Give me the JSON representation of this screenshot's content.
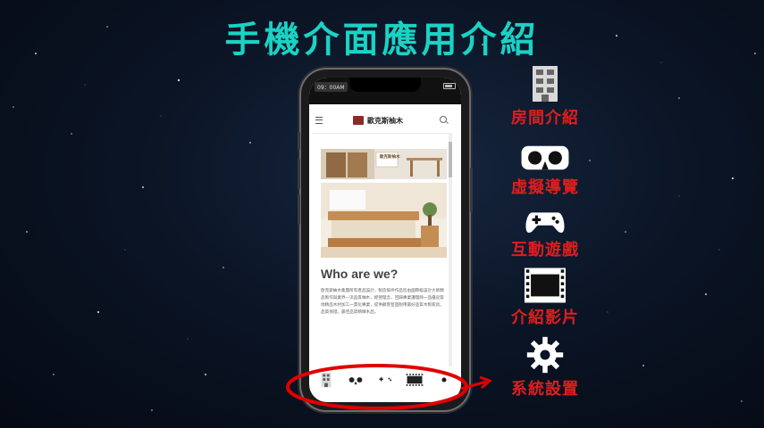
{
  "slide": {
    "title": "手機介面應用介紹"
  },
  "phone": {
    "status_time": "09：00AM",
    "site": {
      "logo_text": "歐克斯柚木",
      "hero_text": "歐克斯柚木"
    },
    "content": {
      "heading": "Who are we?",
      "paragraph": "歐克斯柚木集團所有產品設計，製造每件作品皆由國際級設計大師精品製作與業界一流品質柚木，經營理念，回歸專業護理師一品優良質地精品木材加工一貫化專業，提供顧客堅固耐用最好品質木製家具，品質保證。最佳品質精緻木品。"
    },
    "navbar": [
      {
        "icon": "building-icon"
      },
      {
        "icon": "vr-goggles-icon"
      },
      {
        "icon": "gamepad-icon"
      },
      {
        "icon": "film-icon"
      },
      {
        "icon": "gear-icon"
      }
    ]
  },
  "legend": [
    {
      "icon": "building-icon",
      "label": "房間介紹"
    },
    {
      "icon": "vr-goggles-icon",
      "label": "虛擬導覽"
    },
    {
      "icon": "gamepad-icon",
      "label": "互動遊戲"
    },
    {
      "icon": "film-icon",
      "label": "介紹影片"
    },
    {
      "icon": "gear-icon",
      "label": "系統設置"
    }
  ],
  "colors": {
    "title": "#19d3c5",
    "legend_label": "#e01e1e",
    "highlight_circle": "#e00000"
  }
}
